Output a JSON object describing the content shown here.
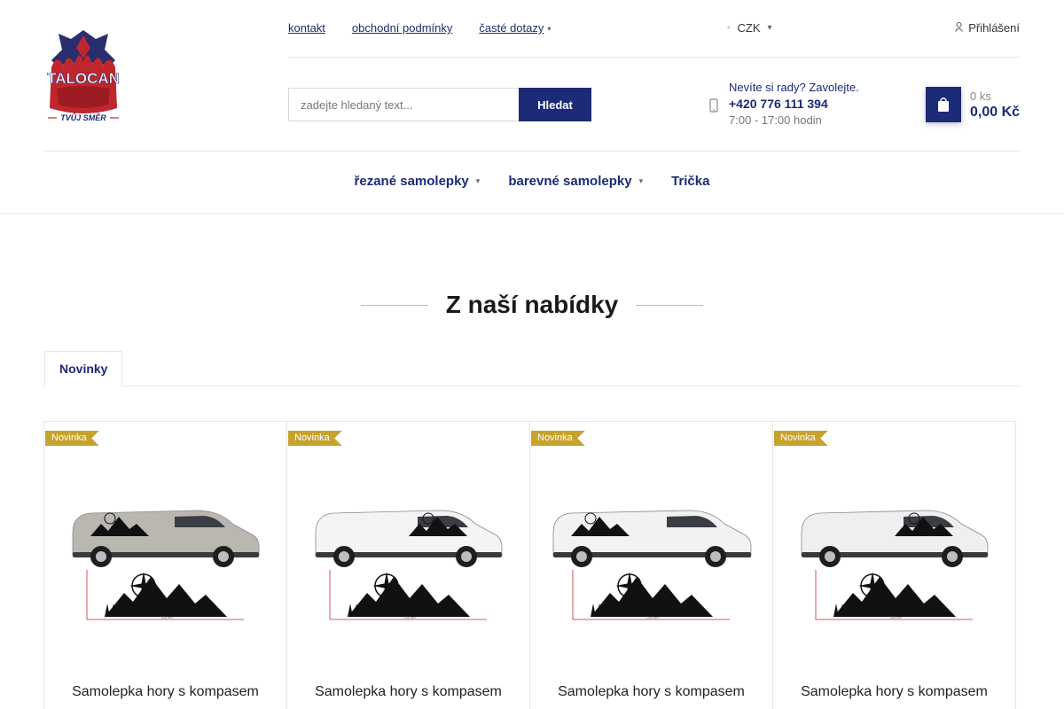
{
  "header": {
    "logo_text": "TALOCAN",
    "logo_tagline": "TVŮJ SMĚR",
    "top_links": [
      {
        "label": "kontakt"
      },
      {
        "label": "obchodní podmínky"
      },
      {
        "label": "časté dotazy"
      }
    ],
    "currency": "CZK",
    "login_label": "Přihlášení",
    "search": {
      "placeholder": "zadejte hledaný text...",
      "button_label": "Hledat"
    },
    "contact": {
      "question": "Nevíte si rady? Zavolejte.",
      "phone": "+420 776 111 394",
      "hours": "7:00 - 17:00 hodin"
    },
    "cart": {
      "quantity": "0 ks",
      "total": "0,00 Kč"
    }
  },
  "nav": {
    "items": [
      {
        "label": "řezané samolepky"
      },
      {
        "label": "barevné samolepky"
      },
      {
        "label": "Trička"
      }
    ]
  },
  "section": {
    "title": "Z naší nabídky",
    "tab_label": "Novinky"
  },
  "products": [
    {
      "badge": "Novinka",
      "name": "Samolepka hory s kompasem",
      "dimension": "200 cm"
    },
    {
      "badge": "Novinka",
      "name": "Samolepka hory s kompasem",
      "dimension": "200 cm"
    },
    {
      "badge": "Novinka",
      "name": "Samolepka hory s kompasem",
      "dimension": "200 cm"
    },
    {
      "badge": "Novinka",
      "name": "Samolepka hory s kompasem",
      "dimension": "200 cm"
    }
  ],
  "colors": {
    "brand_navy": "#1c2a78",
    "badge_gold": "#c7a22c",
    "logo_red": "#c0272d"
  }
}
